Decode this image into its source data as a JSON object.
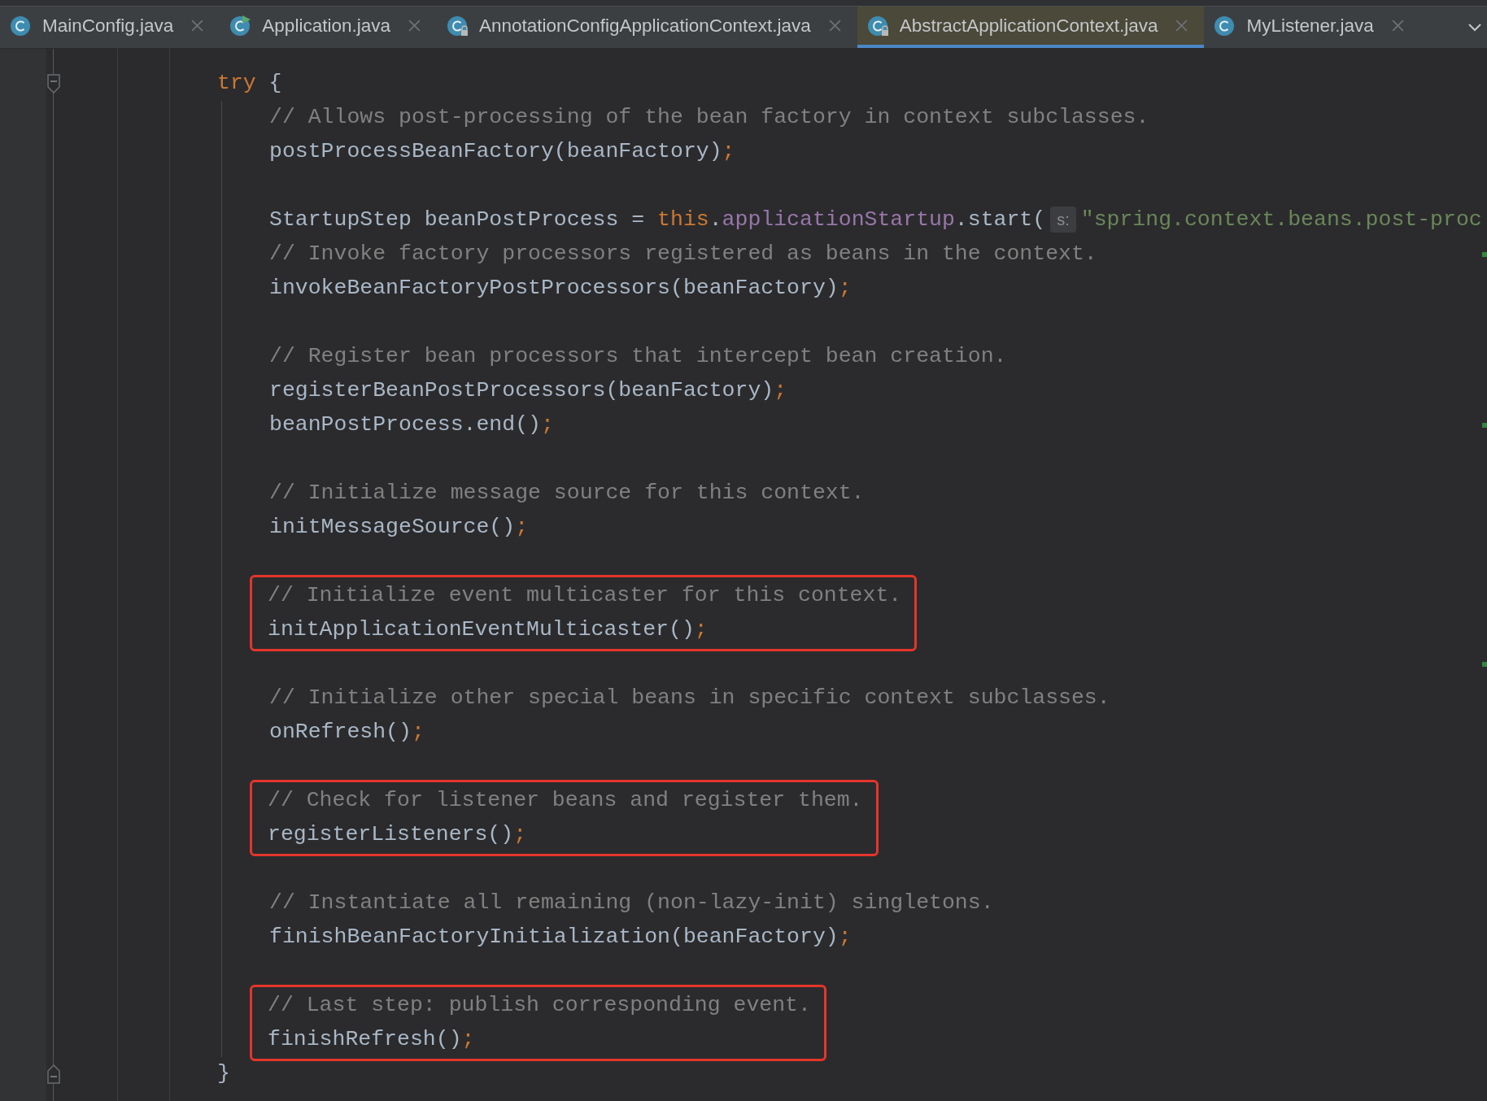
{
  "tabs": [
    {
      "label": "MainConfig.java",
      "selected": false,
      "runnable": false,
      "locked": false
    },
    {
      "label": "Application.java",
      "selected": false,
      "runnable": true,
      "locked": false
    },
    {
      "label": "AnnotationConfigApplicationContext.java",
      "selected": false,
      "runnable": false,
      "locked": true
    },
    {
      "label": "AbstractApplicationContext.java",
      "selected": true,
      "runnable": false,
      "locked": true
    },
    {
      "label": "MyListener.java",
      "selected": false,
      "runnable": false,
      "locked": false
    }
  ],
  "editor": {
    "opening": {
      "tokens": [
        {
          "kind": "keyword",
          "text": "try"
        },
        {
          "kind": "plain",
          "text": " {"
        }
      ]
    },
    "lines": [
      {
        "kind": "code",
        "highlighted": false,
        "changed": false,
        "tokens": [
          {
            "kind": "comment",
            "text": "// Allows post-processing of the bean factory in context subclasses."
          }
        ]
      },
      {
        "kind": "code",
        "highlighted": false,
        "changed": false,
        "tokens": [
          {
            "kind": "plain",
            "text": "postProcessBeanFactory(beanFactory)"
          },
          {
            "kind": "semicolon",
            "text": ";"
          }
        ]
      },
      {
        "kind": "blank",
        "highlighted": false,
        "changed": false
      },
      {
        "kind": "code",
        "highlighted": false,
        "changed": false,
        "tokens": [
          {
            "kind": "plain",
            "text": "StartupStep beanPostProcess = "
          },
          {
            "kind": "keyword",
            "text": "this"
          },
          {
            "kind": "plain",
            "text": "."
          },
          {
            "kind": "field",
            "text": "applicationStartup"
          },
          {
            "kind": "plain",
            "text": ".start("
          },
          {
            "kind": "hint",
            "text": "s:"
          },
          {
            "kind": "string",
            "text": "\"spring.context.beans.post-proc"
          }
        ]
      },
      {
        "kind": "code",
        "highlighted": false,
        "changed": true,
        "tokens": [
          {
            "kind": "comment",
            "text": "// Invoke factory processors registered as beans in the context."
          }
        ]
      },
      {
        "kind": "code",
        "highlighted": false,
        "changed": false,
        "tokens": [
          {
            "kind": "plain",
            "text": "invokeBeanFactoryPostProcessors(beanFactory)"
          },
          {
            "kind": "semicolon",
            "text": ";"
          }
        ]
      },
      {
        "kind": "blank",
        "highlighted": false,
        "changed": false
      },
      {
        "kind": "code",
        "highlighted": false,
        "changed": false,
        "tokens": [
          {
            "kind": "comment",
            "text": "// Register bean processors that intercept bean creation."
          }
        ]
      },
      {
        "kind": "code",
        "highlighted": false,
        "changed": false,
        "tokens": [
          {
            "kind": "plain",
            "text": "registerBeanPostProcessors(beanFactory)"
          },
          {
            "kind": "semicolon",
            "text": ";"
          }
        ]
      },
      {
        "kind": "code",
        "highlighted": false,
        "changed": true,
        "tokens": [
          {
            "kind": "plain",
            "text": "beanPostProcess.end()"
          },
          {
            "kind": "semicolon",
            "text": ";"
          }
        ]
      },
      {
        "kind": "blank",
        "highlighted": false,
        "changed": false
      },
      {
        "kind": "code",
        "highlighted": false,
        "changed": false,
        "tokens": [
          {
            "kind": "comment",
            "text": "// Initialize message source for this context."
          }
        ]
      },
      {
        "kind": "code",
        "highlighted": false,
        "changed": false,
        "tokens": [
          {
            "kind": "plain",
            "text": "initMessageSource()"
          },
          {
            "kind": "semicolon",
            "text": ";"
          }
        ]
      },
      {
        "kind": "blank",
        "highlighted": false,
        "changed": false
      },
      {
        "kind": "code",
        "highlighted": true,
        "changed": false,
        "tokens": [
          {
            "kind": "comment",
            "text": "// Initialize event multicaster for this context."
          }
        ]
      },
      {
        "kind": "code",
        "highlighted": true,
        "changed": false,
        "tokens": [
          {
            "kind": "plain",
            "text": "initApplicationEventMulticaster()"
          },
          {
            "kind": "semicolon",
            "text": ";"
          }
        ]
      },
      {
        "kind": "blank",
        "highlighted": false,
        "changed": true
      },
      {
        "kind": "code",
        "highlighted": false,
        "changed": false,
        "tokens": [
          {
            "kind": "comment",
            "text": "// Initialize other special beans in specific context subclasses."
          }
        ]
      },
      {
        "kind": "code",
        "highlighted": false,
        "changed": false,
        "tokens": [
          {
            "kind": "plain",
            "text": "onRefresh()"
          },
          {
            "kind": "semicolon",
            "text": ";"
          }
        ]
      },
      {
        "kind": "blank",
        "highlighted": false,
        "changed": false
      },
      {
        "kind": "code",
        "highlighted": true,
        "changed": false,
        "tokens": [
          {
            "kind": "comment",
            "text": "// Check for listener beans and register them."
          }
        ]
      },
      {
        "kind": "code",
        "highlighted": true,
        "changed": false,
        "tokens": [
          {
            "kind": "plain",
            "text": "registerListeners()"
          },
          {
            "kind": "semicolon",
            "text": ";"
          }
        ]
      },
      {
        "kind": "blank",
        "highlighted": false,
        "changed": false
      },
      {
        "kind": "code",
        "highlighted": false,
        "changed": false,
        "tokens": [
          {
            "kind": "comment",
            "text": "// Instantiate all remaining (non-lazy-init) singletons."
          }
        ]
      },
      {
        "kind": "code",
        "highlighted": false,
        "changed": false,
        "tokens": [
          {
            "kind": "plain",
            "text": "finishBeanFactoryInitialization(beanFactory)"
          },
          {
            "kind": "semicolon",
            "text": ";"
          }
        ]
      },
      {
        "kind": "blank",
        "highlighted": false,
        "changed": false
      },
      {
        "kind": "code",
        "highlighted": true,
        "changed": false,
        "tokens": [
          {
            "kind": "comment",
            "text": "// Last step: publish corresponding event."
          }
        ]
      },
      {
        "kind": "code",
        "highlighted": true,
        "changed": false,
        "tokens": [
          {
            "kind": "plain",
            "text": "finishRefresh()"
          },
          {
            "kind": "semicolon",
            "text": ";"
          }
        ]
      }
    ],
    "closing": {
      "tokens": [
        {
          "kind": "plain",
          "text": "}"
        }
      ]
    }
  }
}
